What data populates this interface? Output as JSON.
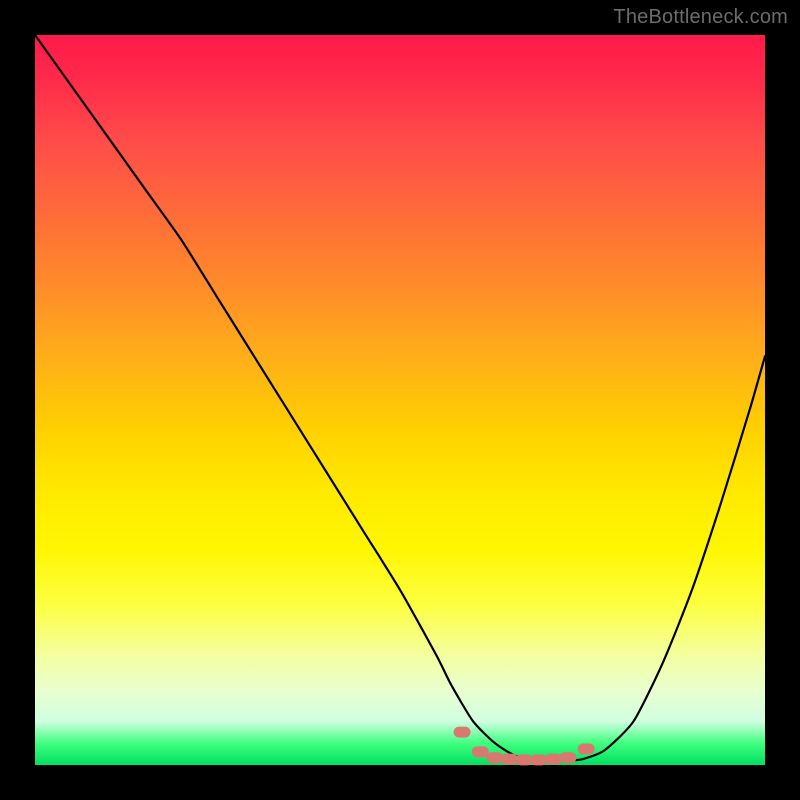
{
  "watermark": "TheBottleneck.com",
  "colors": {
    "curve_stroke": "#000000",
    "marker_fill": "#d9786e",
    "marker_stroke": "#d9786e",
    "background": "#000000"
  },
  "chart_data": {
    "type": "line",
    "title": "",
    "xlabel": "",
    "ylabel": "",
    "xlim": [
      0,
      100
    ],
    "ylim": [
      0,
      100
    ],
    "grid": false,
    "legend": false,
    "series": [
      {
        "name": "bottleneck-curve",
        "x": [
          0,
          5,
          10,
          15,
          20,
          25,
          30,
          35,
          40,
          45,
          50,
          55,
          57,
          60,
          63,
          66,
          70,
          73,
          75,
          78,
          82,
          86,
          90,
          94,
          98,
          100
        ],
        "y": [
          100,
          93,
          86,
          79,
          72,
          64,
          56,
          48,
          40,
          32,
          24,
          15,
          11,
          6,
          3,
          1.2,
          0.6,
          0.6,
          0.8,
          2,
          6,
          14,
          24,
          36,
          49,
          56
        ]
      }
    ],
    "markers": {
      "name": "valley-markers",
      "x": [
        58.5,
        61,
        63,
        65,
        67,
        69,
        71,
        73,
        75.5
      ],
      "y": [
        4.5,
        1.8,
        1.0,
        0.8,
        0.7,
        0.7,
        0.8,
        1.0,
        2.2
      ]
    }
  }
}
